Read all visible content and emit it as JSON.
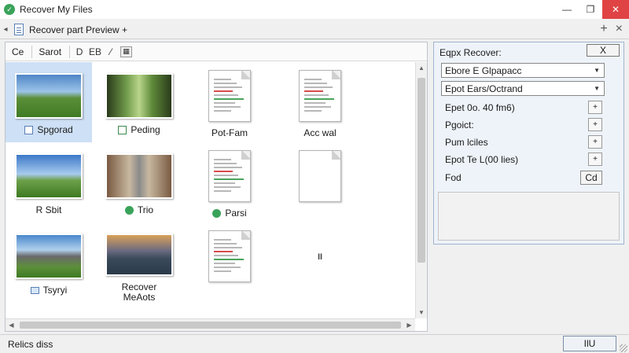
{
  "window": {
    "title": "Recover My Files",
    "minimize": "—",
    "maximize": "❐",
    "close": "✕"
  },
  "tabbar": {
    "left_arrow": "◂",
    "tab_label": "Recover part Preview +",
    "add": "+",
    "close": "×"
  },
  "toolbar": {
    "btn1": "Ce",
    "btn2": "Sarot",
    "icon3": "D",
    "icon4": "EB",
    "icon5": "⁄"
  },
  "files": [
    {
      "label": "Spgorad",
      "kind": "photo",
      "scene": "meadow",
      "icon": "file-icon",
      "selected": true
    },
    {
      "label": "Peding",
      "kind": "photo",
      "scene": "forest",
      "icon": "edit-icon",
      "selected": false
    },
    {
      "label": "Pot-Fam",
      "kind": "doc",
      "icon": "",
      "selected": false
    },
    {
      "label": "Acc wal",
      "kind": "doc",
      "icon": "",
      "selected": false
    },
    {
      "label": "R Sbit",
      "kind": "photo",
      "scene": "hills",
      "icon": "",
      "selected": false
    },
    {
      "label": "Trio",
      "kind": "photo",
      "scene": "street",
      "icon": "green-circle-icon",
      "selected": false
    },
    {
      "label": "Parsi",
      "kind": "doc",
      "icon": "green-circle-icon",
      "selected": false
    },
    {
      "label": "",
      "kind": "doc-blank",
      "icon": "",
      "selected": false
    },
    {
      "label": "Tsyryi",
      "kind": "photo",
      "scene": "mountain",
      "icon": "folder-icon",
      "selected": false
    },
    {
      "label": "Recover\nMeAots",
      "kind": "photo",
      "scene": "lake",
      "icon": "",
      "selected": false
    },
    {
      "label": "",
      "kind": "doc",
      "icon": "",
      "selected": false
    },
    {
      "label": "",
      "kind": "pause",
      "icon": "",
      "selected": false
    }
  ],
  "pause_glyph": "II",
  "right_panel": {
    "title": "Eqpx Recover:",
    "close_label": "X",
    "select1": "Ebore E Glpapacc",
    "select2": "Epot Ears/Octrand",
    "rows": [
      {
        "label": "Epet 0o. 40 fm6)",
        "action": "+"
      },
      {
        "label": "Pgoict:",
        "action": "+"
      },
      {
        "label": "Pum lciles",
        "action": "+"
      },
      {
        "label": "Epot Te L(00 lies)",
        "action": "+"
      }
    ],
    "last_row_label": "Fod",
    "last_row_btn": "Cd"
  },
  "status": {
    "text": "Relics diss",
    "button": "IlU"
  },
  "colors": {
    "selection": "#cde0f5",
    "close_red": "#e04343",
    "accent_green": "#3aa35a"
  }
}
